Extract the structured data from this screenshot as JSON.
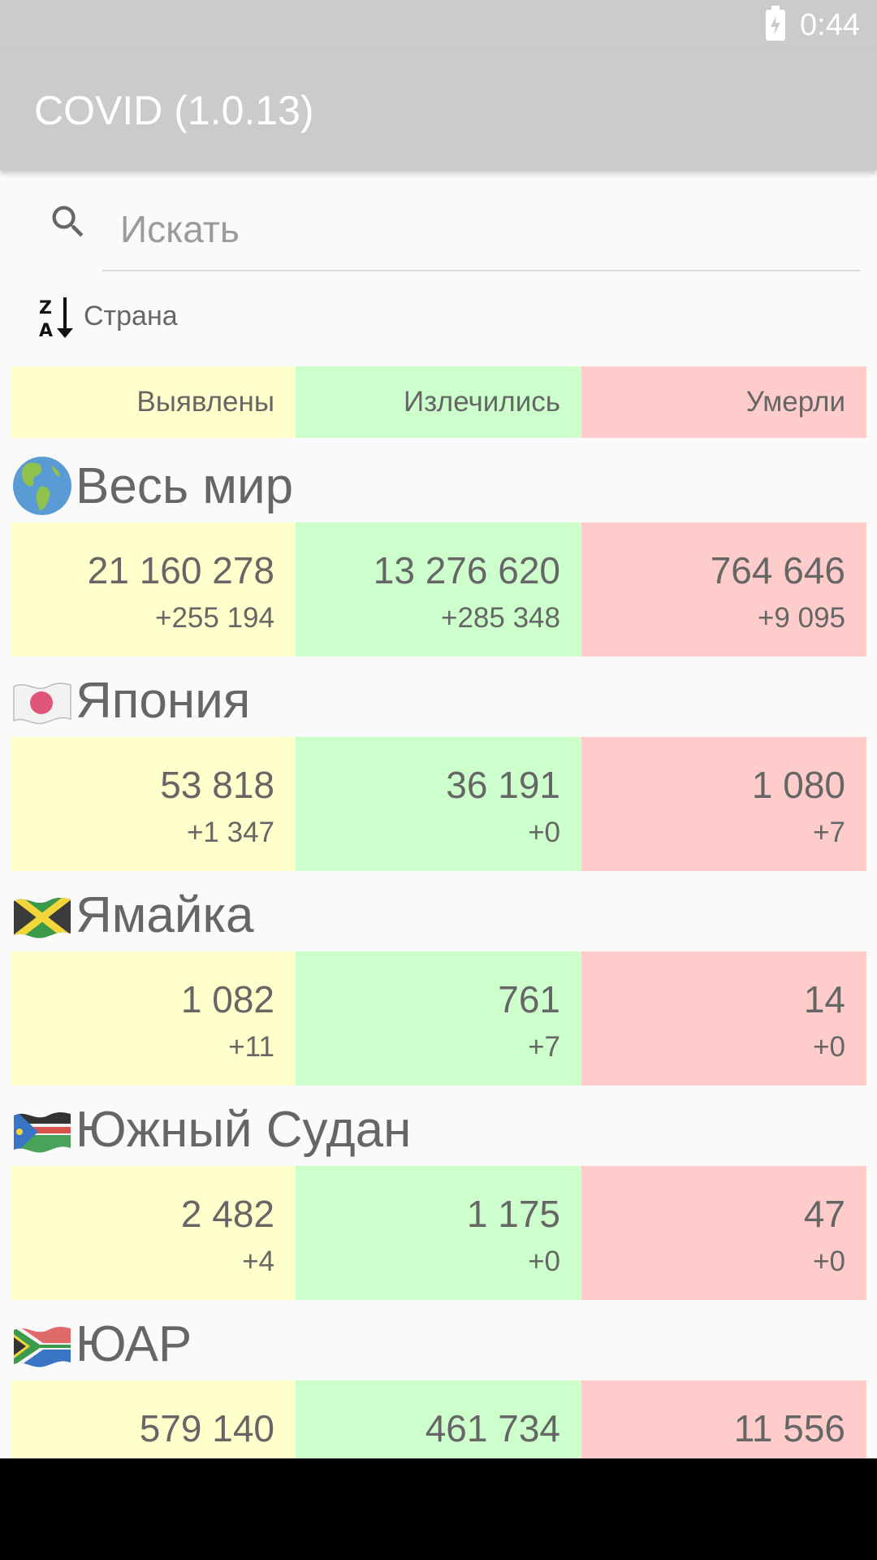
{
  "status_bar": {
    "time": "0:44"
  },
  "app": {
    "title": "COVID (1.0.13)"
  },
  "search": {
    "placeholder": "Искать",
    "value": ""
  },
  "sort": {
    "label": "Страна",
    "icon": "sort-z-a-icon"
  },
  "columns": {
    "confirmed": "Выявлены",
    "recovered": "Излечились",
    "deaths": "Умерли"
  },
  "colors": {
    "confirmed_bg": "#ffffcc",
    "recovered_bg": "#ccffcc",
    "deaths_bg": "#ffcccc",
    "app_bar": "#cbcbcb"
  },
  "countries": [
    {
      "name": "Весь мир",
      "icon": "globe-americas-icon",
      "confirmed": "21 160 278",
      "confirmed_delta": "+255 194",
      "recovered": "13 276 620",
      "recovered_delta": "+285 348",
      "deaths": "764 646",
      "deaths_delta": "+9 095"
    },
    {
      "name": "Япония",
      "icon": "flag-japan-icon",
      "confirmed": "53 818",
      "confirmed_delta": "+1 347",
      "recovered": "36 191",
      "recovered_delta": "+0",
      "deaths": "1 080",
      "deaths_delta": "+7"
    },
    {
      "name": "Ямайка",
      "icon": "flag-jamaica-icon",
      "confirmed": "1 082",
      "confirmed_delta": "+11",
      "recovered": "761",
      "recovered_delta": "+7",
      "deaths": "14",
      "deaths_delta": "+0"
    },
    {
      "name": "Южный Судан",
      "icon": "flag-south-sudan-icon",
      "confirmed": "2 482",
      "confirmed_delta": "+4",
      "recovered": "1 175",
      "recovered_delta": "+0",
      "deaths": "47",
      "deaths_delta": "+0"
    },
    {
      "name": "ЮАР",
      "icon": "flag-south-africa-icon",
      "confirmed": "579 140",
      "recovered": "461 734",
      "deaths": "11 556"
    }
  ]
}
